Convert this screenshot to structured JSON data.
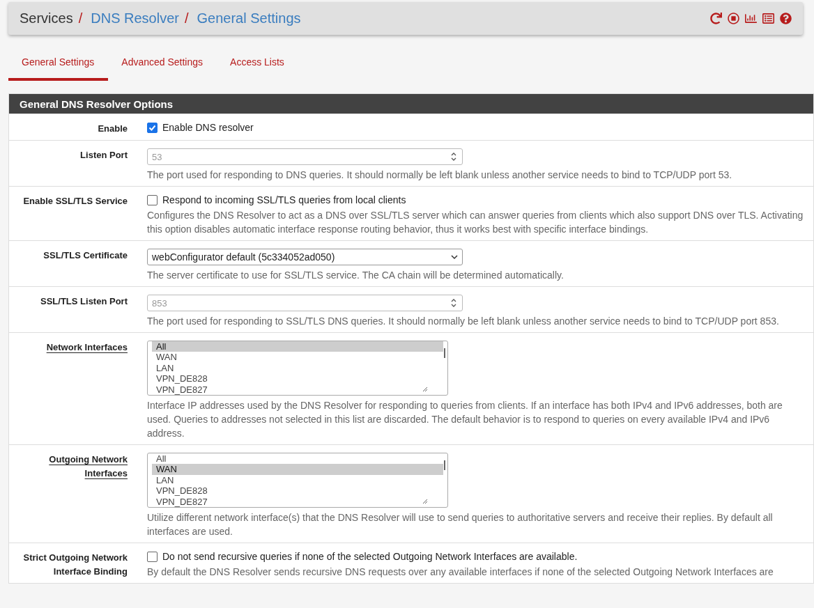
{
  "breadcrumb": [
    {
      "label": "Services",
      "kind": "plain"
    },
    {
      "label": "DNS Resolver",
      "kind": "link"
    },
    {
      "label": "General Settings",
      "kind": "link"
    }
  ],
  "separator": "/",
  "tabs": [
    {
      "label": "General Settings",
      "selected": true
    },
    {
      "label": "Advanced Settings",
      "selected": false
    },
    {
      "label": "Access Lists",
      "selected": false
    }
  ],
  "panel": {
    "title": "General DNS Resolver Options",
    "rows": [
      {
        "label": "Enable",
        "label_link": false,
        "kind": "checkbox",
        "checked": true,
        "text": "Enable DNS resolver"
      },
      {
        "label": "Listen Port",
        "label_link": false,
        "kind": "number",
        "placeholder": "53",
        "help": "The port used for responding to DNS queries. It should normally be left blank unless another service needs to bind to TCP/UDP port 53."
      },
      {
        "label": "Enable SSL/TLS Service",
        "label_link": false,
        "kind": "checkbox",
        "checked": false,
        "text": "Respond to incoming SSL/TLS queries from local clients",
        "help": "Configures the DNS Resolver to act as a DNS over SSL/TLS server which can answer queries from clients which also support DNS over TLS. Activating this option disables automatic interface response routing behavior, thus it works best with specific interface bindings."
      },
      {
        "label": "SSL/TLS Certificate",
        "label_link": false,
        "kind": "select",
        "value": "webConfigurator default (5c334052ad050)",
        "help": "The server certificate to use for SSL/TLS service. The CA chain will be determined automatically."
      },
      {
        "label": "SSL/TLS Listen Port",
        "label_link": false,
        "kind": "number",
        "placeholder": "853",
        "help": "The port used for responding to SSL/TLS DNS queries. It should normally be left blank unless another service needs to bind to TCP/UDP port 853."
      },
      {
        "label": "Network Interfaces",
        "label_link": true,
        "kind": "listbox",
        "options": [
          {
            "label": "All",
            "selected": true
          },
          {
            "label": "WAN",
            "selected": false
          },
          {
            "label": "LAN",
            "selected": false
          },
          {
            "label": "VPN_DE828",
            "selected": false
          },
          {
            "label": "VPN_DE827",
            "selected": false
          }
        ],
        "help": "Interface IP addresses used by the DNS Resolver for responding to queries from clients. If an interface has both IPv4 and IPv6 addresses, both are used. Queries to addresses not selected in this list are discarded. The default behavior is to respond to queries on every available IPv4 and IPv6 address."
      },
      {
        "label": "Outgoing Network Interfaces",
        "label_link": true,
        "kind": "listbox",
        "options": [
          {
            "label": "All",
            "selected": false
          },
          {
            "label": "WAN",
            "selected": true
          },
          {
            "label": "LAN",
            "selected": false
          },
          {
            "label": "VPN_DE828",
            "selected": false
          },
          {
            "label": "VPN_DE827",
            "selected": false
          }
        ],
        "help": "Utilize different network interface(s) that the DNS Resolver will use to send queries to authoritative servers and receive their replies. By default all interfaces are used."
      },
      {
        "label": "Strict Outgoing Network Interface Binding",
        "label_link": false,
        "kind": "checkbox",
        "checked": false,
        "text": "Do not send recursive queries if none of the selected Outgoing Network Interfaces are available.",
        "help": "By default the DNS Resolver sends recursive DNS requests over any available interfaces if none of the selected Outgoing Network Interfaces are"
      }
    ]
  }
}
